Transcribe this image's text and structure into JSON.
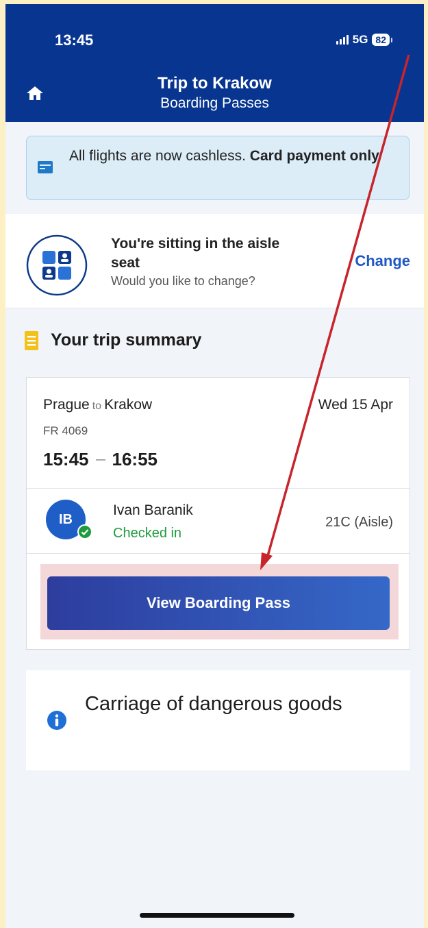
{
  "status_bar": {
    "time": "13:45",
    "network": "5G",
    "battery": "82"
  },
  "header": {
    "title": "Trip to Krakow",
    "subtitle": "Boarding Passes"
  },
  "notice": {
    "text": "All flights are now cashless. ",
    "bold": "Card payment only"
  },
  "seat_prompt": {
    "title": "You're sitting in the aisle seat",
    "subtitle": "Would you like to change?",
    "action": "Change"
  },
  "summary": {
    "heading": "Your trip summary"
  },
  "flight": {
    "origin": "Prague",
    "connector": "to",
    "destination": "Krakow",
    "date": "Wed 15 Apr",
    "number": "FR 4069",
    "depart": "15:45",
    "arrive": "16:55"
  },
  "passenger": {
    "initials": "IB",
    "name": "Ivan Baranik",
    "status": "Checked in",
    "seat": "21C (Aisle)"
  },
  "boarding_button": {
    "label": "View Boarding Pass"
  },
  "dangerous_goods": {
    "label": "Carriage of dangerous goods"
  },
  "colors": {
    "header_bg": "#073590",
    "accent_link": "#1f58c3",
    "checked_in": "#1f9a3f",
    "annotation_arrow": "#c8242b",
    "annotation_highlight": "#f4d8d9"
  },
  "icons": [
    "home-icon",
    "card-icon",
    "seat-map-icon",
    "document-icon",
    "check-badge-icon",
    "info-icon"
  ]
}
